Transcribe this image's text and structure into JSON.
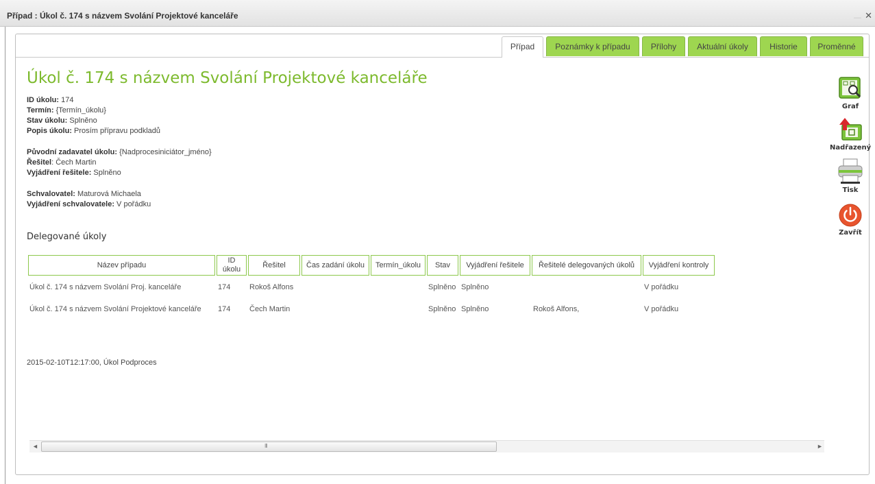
{
  "window": {
    "title": "Případ : Úkol č. 174 s názvem Svolání Projektové kanceláře",
    "minimize_glyph": "—",
    "close_glyph": "✕"
  },
  "tabs": [
    "Případ",
    "Poznámky k případu",
    "Přílohy",
    "Aktuální úkoly",
    "Historie",
    "Proměnné"
  ],
  "active_tab": "Případ",
  "heading": "Úkol č. 174 s názvem Svolání Projektové kanceláře",
  "details": {
    "id_label": "ID úkolu:",
    "id_value": " 174",
    "termin_label": "Termín:",
    "termin_value": " {Termín_úkolu}",
    "stav_label": "Stav úkolu:",
    "stav_value": " Splněno",
    "popis_label": "Popis úkolu:",
    "popis_value": " Prosím přípravu podkladů",
    "zadavatel_label": "Původní zadavatel úkolu:",
    "zadavatel_value": " {Nadprocesiniciátor_jméno}",
    "resitel_label": "Řešitel",
    "resitel_value": ": Čech Martin",
    "vyjadreni_label": "Vyjádření řešitele:",
    "vyjadreni_value": " Splněno",
    "schvalovatel_label": "Schvalovatel:",
    "schvalovatel_value": " Maturová Michaela",
    "vyj_schval_label": "Vyjádření schvalovatele:",
    "vyj_schval_value": " V pořádku"
  },
  "section_title": "Delegované úkoly",
  "table": {
    "headers": [
      "Název případu",
      "ID úkolu",
      "Řešitel",
      "Čas zadání úkolu",
      "Termín_úkolu",
      "Stav",
      "Vyjádření řešitele",
      "Řešitelé delegovaných úkolů",
      "Vyjádření kontroly"
    ],
    "rows": [
      [
        "Úkol č. 174 s názvem Svolání Proj. kanceláře",
        "174",
        "Rokoš Alfons",
        "",
        "",
        "Splněno",
        "Splněno",
        "",
        "V pořádku"
      ],
      [
        "Úkol č. 174 s názvem Svolání Projektové kanceláře",
        "174",
        "Čech Martin",
        "",
        "",
        "Splněno",
        "Splněno",
        "Rokoš Alfons,",
        "V pořádku"
      ]
    ]
  },
  "footer_text": "2015-02-10T12:17:00, Úkol Podproces",
  "scrollbar": {
    "left_arrow": "◄",
    "right_arrow": "►",
    "grip": "III"
  },
  "actions": [
    "Graf",
    "Nadřazený",
    "Tisk",
    "Zavřít"
  ],
  "colors": {
    "accent_green": "#7dba2e",
    "tab_green": "#9ed650",
    "close_red": "#e8542e"
  }
}
